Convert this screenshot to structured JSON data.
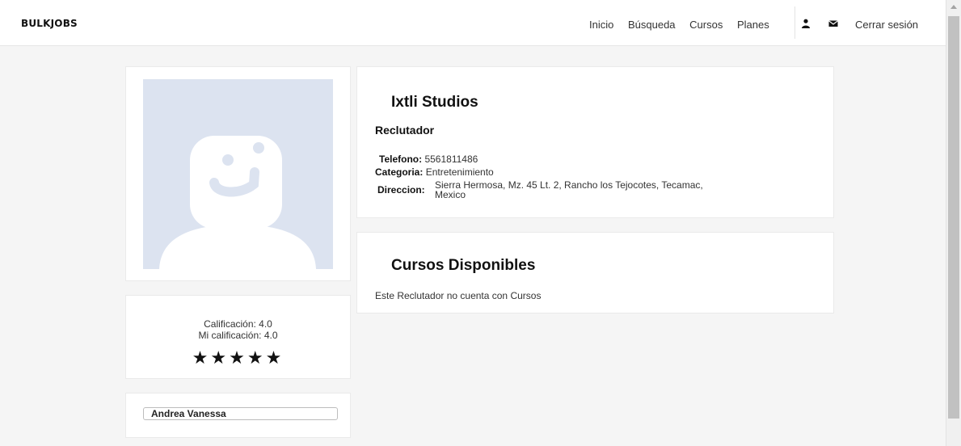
{
  "nav": {
    "brand": "BULKJOBS",
    "links": [
      "Inicio",
      "Búsqueda",
      "Cursos",
      "Planes"
    ],
    "logout": "Cerrar sesión",
    "icons": [
      "user-icon",
      "envelope-icon"
    ]
  },
  "profile": {
    "rating_label": "Calificación: 4.0",
    "my_rating_label": "Mi calificación: 4.0",
    "stars": 5,
    "name": "Andrea Vanessa"
  },
  "company": {
    "name": "Ixtli Studios",
    "role": "Reclutador",
    "phone_label": "Telefono:",
    "phone": "5561811486",
    "category_label": "Categoria:",
    "category": "Entretenimiento",
    "address_label": "Direccion:",
    "address_line1": "Sierra Hermosa, Mz. 45 Lt. 2, Rancho los Tejocotes, Tecamac,",
    "address_line2": "Mexico"
  },
  "courses": {
    "title": "Cursos Disponibles",
    "empty_text": "Este Reclutador no cuenta con Cursos"
  },
  "colors": {
    "avatar_bg": "#dce3f0",
    "avatar_fg": "#ffffff"
  }
}
